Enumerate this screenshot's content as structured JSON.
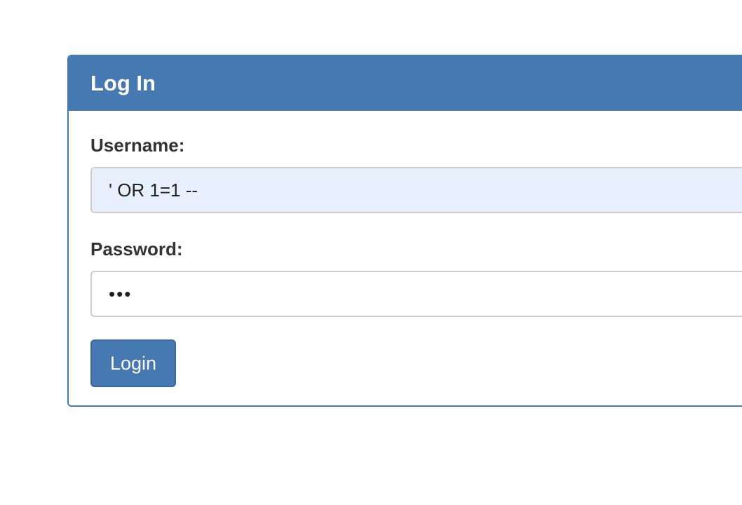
{
  "panel": {
    "title": "Log In"
  },
  "form": {
    "username_label": "Username:",
    "username_value": "' OR 1=1 --",
    "password_label": "Password:",
    "password_value": "•••",
    "login_label": "Login"
  },
  "colors": {
    "primary": "#4678b2",
    "autofill_background": "#e8f0fe",
    "label_text": "#333333"
  }
}
